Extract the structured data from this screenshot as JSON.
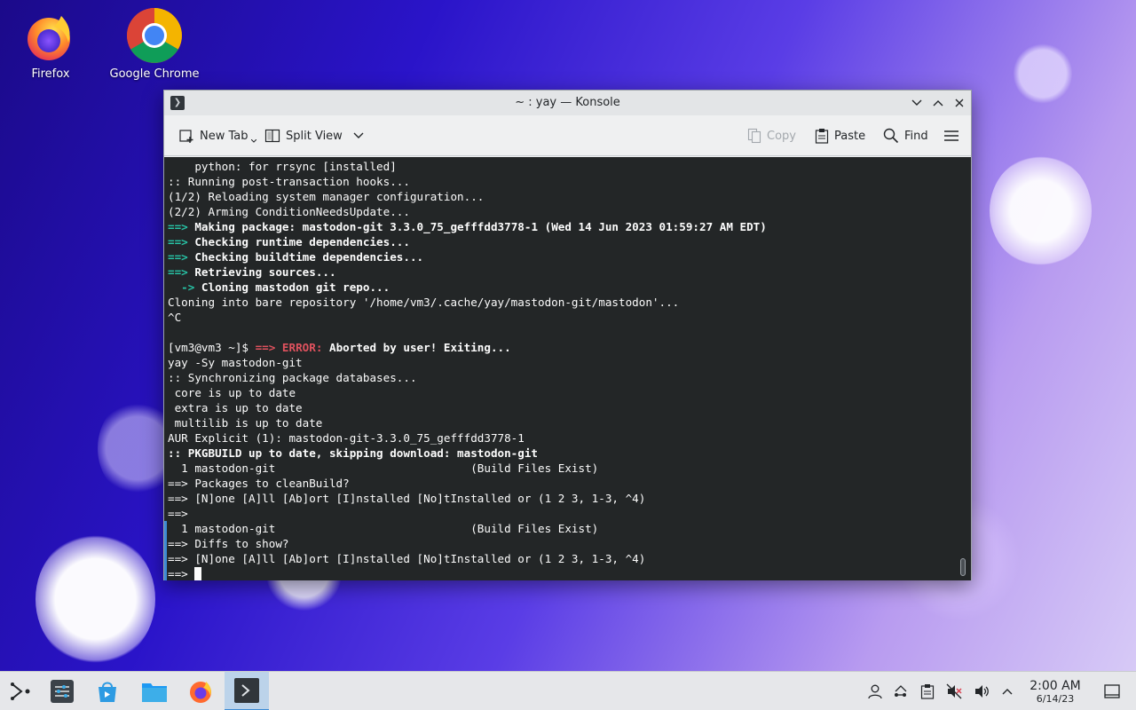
{
  "desktop": {
    "icons": [
      {
        "label": "Firefox",
        "icon": "firefox-icon"
      },
      {
        "label": "Google Chrome",
        "icon": "chrome-icon"
      }
    ]
  },
  "window": {
    "title": "~ : yay — Konsole",
    "toolbar": {
      "new_tab": "New Tab",
      "split_view": "Split View",
      "copy": "Copy",
      "paste": "Paste",
      "find": "Find"
    }
  },
  "terminal": {
    "lines": [
      [
        {
          "t": "    python: for rrsync [installed]"
        }
      ],
      [
        {
          "t": ":: Running post-transaction hooks..."
        }
      ],
      [
        {
          "t": "(1/2) Reloading system manager configuration..."
        }
      ],
      [
        {
          "t": "(2/2) Arming ConditionNeedsUpdate..."
        }
      ],
      [
        {
          "t": "==> ",
          "s": "g"
        },
        {
          "t": "Making package: mastodon-git 3.3.0_75_gefffdd3778-1 (Wed 14 Jun 2023 01:59:27 AM EDT)",
          "s": "b"
        }
      ],
      [
        {
          "t": "==> ",
          "s": "g"
        },
        {
          "t": "Checking runtime dependencies...",
          "s": "b"
        }
      ],
      [
        {
          "t": "==> ",
          "s": "g"
        },
        {
          "t": "Checking buildtime dependencies...",
          "s": "b"
        }
      ],
      [
        {
          "t": "==> ",
          "s": "g"
        },
        {
          "t": "Retrieving sources...",
          "s": "b"
        }
      ],
      [
        {
          "t": "  -> ",
          "s": "g"
        },
        {
          "t": "Cloning mastodon git repo...",
          "s": "b"
        }
      ],
      [
        {
          "t": "Cloning into bare repository '/home/vm3/.cache/yay/mastodon-git/mastodon'..."
        }
      ],
      [
        {
          "t": "^C"
        }
      ],
      [
        {
          "t": ""
        }
      ],
      [
        {
          "t": "[vm3@vm3 ~]$ "
        },
        {
          "t": "==> ERROR: ",
          "s": "r"
        },
        {
          "t": "Aborted by user! Exiting...",
          "s": "b"
        }
      ],
      [
        {
          "t": "yay -Sy mastodon-git"
        }
      ],
      [
        {
          "t": ":: Synchronizing package databases..."
        }
      ],
      [
        {
          "t": " core is up to date"
        }
      ],
      [
        {
          "t": " extra is up to date"
        }
      ],
      [
        {
          "t": " multilib is up to date"
        }
      ],
      [
        {
          "t": "AUR Explicit (1): mastodon-git-3.3.0_75_gefffdd3778-1"
        }
      ],
      [
        {
          "t": ":: PKGBUILD up to date, skipping download: mastodon-git",
          "s": "b"
        }
      ],
      [
        {
          "t": "  1 mastodon-git                             (Build Files Exist)"
        }
      ],
      [
        {
          "t": "==> Packages to cleanBuild?"
        }
      ],
      [
        {
          "t": "==> [N]one [A]ll [Ab]ort [I]nstalled [No]tInstalled or (1 2 3, 1-3, ^4)"
        }
      ],
      [
        {
          "t": "==>"
        }
      ],
      [
        {
          "t": "  1 mastodon-git                             (Build Files Exist)"
        }
      ],
      [
        {
          "t": "==> Diffs to show?"
        }
      ],
      [
        {
          "t": "==> [N]one [A]ll [Ab]ort [I]nstalled [No]tInstalled or (1 2 3, 1-3, ^4)"
        }
      ],
      [
        {
          "t": "==> "
        }
      ]
    ]
  },
  "taskbar": {
    "apps": [
      "application-launcher-icon",
      "system-settings-icon",
      "discover-icon",
      "dolphin-files-icon",
      "firefox-icon",
      "konsole-icon"
    ],
    "tray": [
      "user-icon",
      "network-icon",
      "clipboard-icon",
      "volume-muted-icon",
      "volume-icon",
      "expand-tray-icon"
    ],
    "clock_time": "2:00 AM",
    "clock_date": "6/14/23"
  },
  "colors": {
    "terminal_bg": "#232627",
    "prompt_green": "#27c3a5",
    "error_red": "#e0525e",
    "accent": "#3d8bd5"
  }
}
